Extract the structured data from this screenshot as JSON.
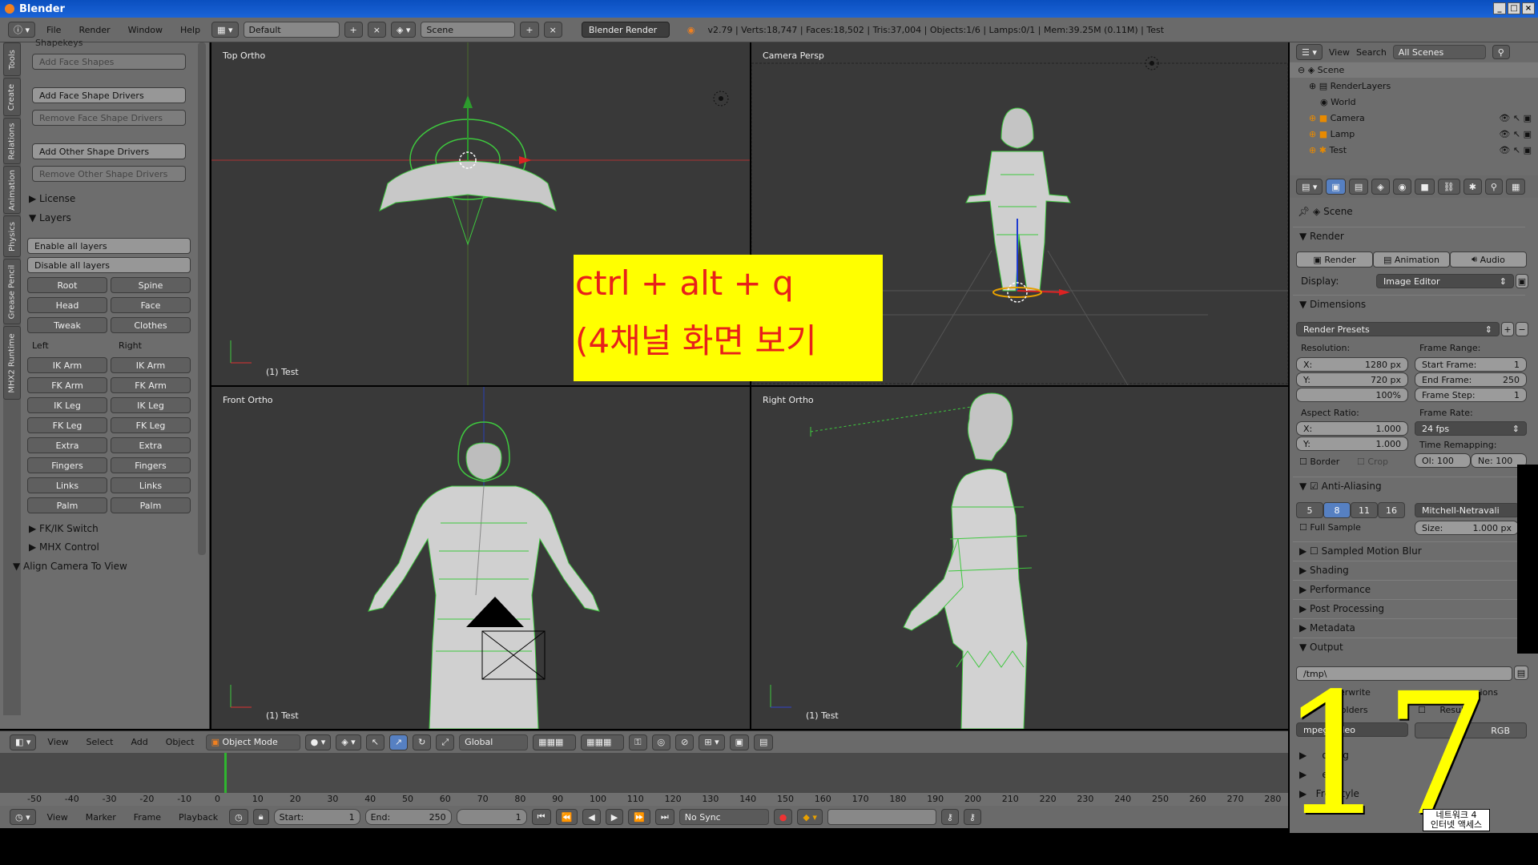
{
  "window": {
    "title": "Blender"
  },
  "infobar": {
    "menus": [
      "File",
      "Render",
      "Window",
      "Help"
    ],
    "layout": "Default",
    "scene": "Scene",
    "engine": "Blender Render",
    "stats": "v2.79 | Verts:18,747 | Faces:18,502 | Tris:37,004 | Objects:1/6 | Lamps:0/1 | Mem:39.25M (0.11M) | Test"
  },
  "toolshelf": {
    "tabs": [
      "Tools",
      "Create",
      "Relations",
      "Animation",
      "Physics",
      "Grease Pencil",
      "MHX2 Runtime"
    ],
    "shapekeys_label": "Shapekeys",
    "add_face_shapes": "Add Face Shapes",
    "add_face_shape_drivers": "Add Face Shape Drivers",
    "remove_face_shape_drivers": "Remove Face Shape Drivers",
    "add_other_shape_drivers": "Add Other Shape Drivers",
    "remove_other_shape_drivers": "Remove Other Shape Drivers",
    "license": "License",
    "layers": "Layers",
    "enable_all": "Enable all layers",
    "disable_all": "Disable all layers",
    "root": "Root",
    "spine": "Spine",
    "head": "Head",
    "face": "Face",
    "tweak": "Tweak",
    "clothes": "Clothes",
    "left": "Left",
    "right": "Right",
    "ik_arm": "IK Arm",
    "fk_arm": "FK Arm",
    "ik_leg": "IK Leg",
    "fk_leg": "FK Leg",
    "extra": "Extra",
    "fingers": "Fingers",
    "links": "Links",
    "palm": "Palm",
    "fkik_switch": "FK/IK Switch",
    "mhx_control": "MHX Control",
    "align_camera": "Align Camera To View"
  },
  "viewports": {
    "top": {
      "label": "Top Ortho",
      "footer": "(1) Test"
    },
    "camera": {
      "label": "Camera Persp"
    },
    "front": {
      "label": "Front Ortho",
      "footer": "(1) Test"
    },
    "right": {
      "label": "Right Ortho",
      "footer": "(1) Test"
    }
  },
  "overlay": {
    "line1": "ctrl + alt + q",
    "line2": "(4채널 화면 보기"
  },
  "viewheader": {
    "menus": [
      "View",
      "Select",
      "Add",
      "Object"
    ],
    "mode": "Object Mode",
    "orientation": "Global"
  },
  "timeline": {
    "ticks": [
      "-50",
      "-40",
      "-30",
      "-20",
      "-10",
      "0",
      "10",
      "20",
      "30",
      "40",
      "50",
      "60",
      "70",
      "80",
      "90",
      "100",
      "110",
      "120",
      "130",
      "140",
      "150",
      "160",
      "170",
      "180",
      "190",
      "200",
      "210",
      "220",
      "230",
      "240",
      "250",
      "260",
      "270",
      "280"
    ],
    "menus": [
      "View",
      "Marker",
      "Frame",
      "Playback"
    ],
    "start_label": "Start:",
    "start_value": "1",
    "end_label": "End:",
    "end_value": "250",
    "current": "1",
    "sync": "No Sync"
  },
  "outliner": {
    "view": "View",
    "search": "Search",
    "filter": "All Scenes",
    "rows": [
      "Scene",
      "RenderLayers",
      "World",
      "Camera",
      "Lamp",
      "Test"
    ]
  },
  "properties": {
    "context": "Scene",
    "render": "Render",
    "render_btn": "Render",
    "animation_btn": "Animation",
    "audio_btn": "Audio",
    "display_label": "Display:",
    "display_value": "Image Editor",
    "dimensions": "Dimensions",
    "presets": "Render Presets",
    "resolution": "Resolution:",
    "res_x_label": "X:",
    "res_x": "1280 px",
    "res_y_label": "Y:",
    "res_y": "720 px",
    "res_pct": "100%",
    "frame_range": "Frame Range:",
    "start_frame_label": "Start Frame:",
    "start_frame": "1",
    "end_frame_label": "End Frame:",
    "end_frame": "250",
    "frame_step_label": "Frame Step:",
    "frame_step": "1",
    "aspect": "Aspect Ratio:",
    "asp_x_label": "X:",
    "asp_x": "1.000",
    "asp_y_label": "Y:",
    "asp_y": "1.000",
    "frame_rate": "Frame Rate:",
    "fps": "24 fps",
    "time_remap": "Time Remapping:",
    "old_label": "Ol: 100",
    "new_label": "Ne: 100",
    "border": "Border",
    "crop": "Crop",
    "aa": "Anti-Aliasing",
    "aa_samples": [
      "5",
      "8",
      "11",
      "16"
    ],
    "filter": "Mitchell-Netravali",
    "full_sample": "Full Sample",
    "size_label": "Size:",
    "size": "1.000 px",
    "sampled_motion_blur": "Sampled Motion Blur",
    "shading": "Shading",
    "performance": "Performance",
    "post_processing": "Post Processing",
    "metadata": "Metadata",
    "output": "Output",
    "path": "/tmp\\",
    "overwrite": "erwrite",
    "extensions": "ensions",
    "placeholders": "ceholders",
    "cache_result": "Result",
    "format": "mpeg video",
    "rgb": "RGB",
    "encoding": "oding",
    "bake": "e",
    "freestyle": "Freestyle"
  },
  "bignum": "17",
  "watermark": {
    "line1": "네트워크 4",
    "line2": "인터넷 액세스"
  }
}
